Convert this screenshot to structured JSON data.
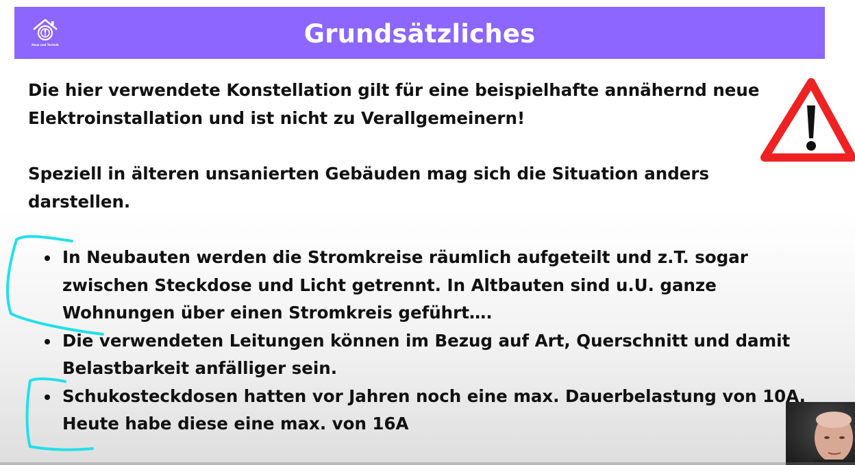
{
  "header": {
    "title": "Grundsätzliches",
    "logo_text": "Haus und Technik",
    "background_color": "#8c66ff"
  },
  "paragraphs": [
    "Die hier verwendete Konstellation gilt für eine beispielhafte annähernd neue Elektroinstallation und ist nicht zu Verallgemeinern!",
    "Speziell in älteren unsanierten Gebäuden mag sich die Situation anders darstellen."
  ],
  "bullets": [
    "In Neubauten werden die Stromkreise räumlich aufgeteilt und z.T. sogar zwischen Steckdose und Licht getrennt. In Altbauten sind u.U. ganze Wohnungen über einen Stromkreis geführt….",
    "Die verwendeten Leitungen können im Bezug auf Art, Querschnitt und damit Belastbarkeit anfälliger sein.",
    "Schukosteckdosen hatten vor Jahren noch eine max. Dauerbelastung von 10A. Heute habe diese eine max.  von 16A"
  ],
  "icons": {
    "logo": "house-plug-icon",
    "warning": "warning-triangle-icon"
  },
  "colors": {
    "warning_red": "#ee2222",
    "annotation_cyan": "#22e0e8"
  }
}
